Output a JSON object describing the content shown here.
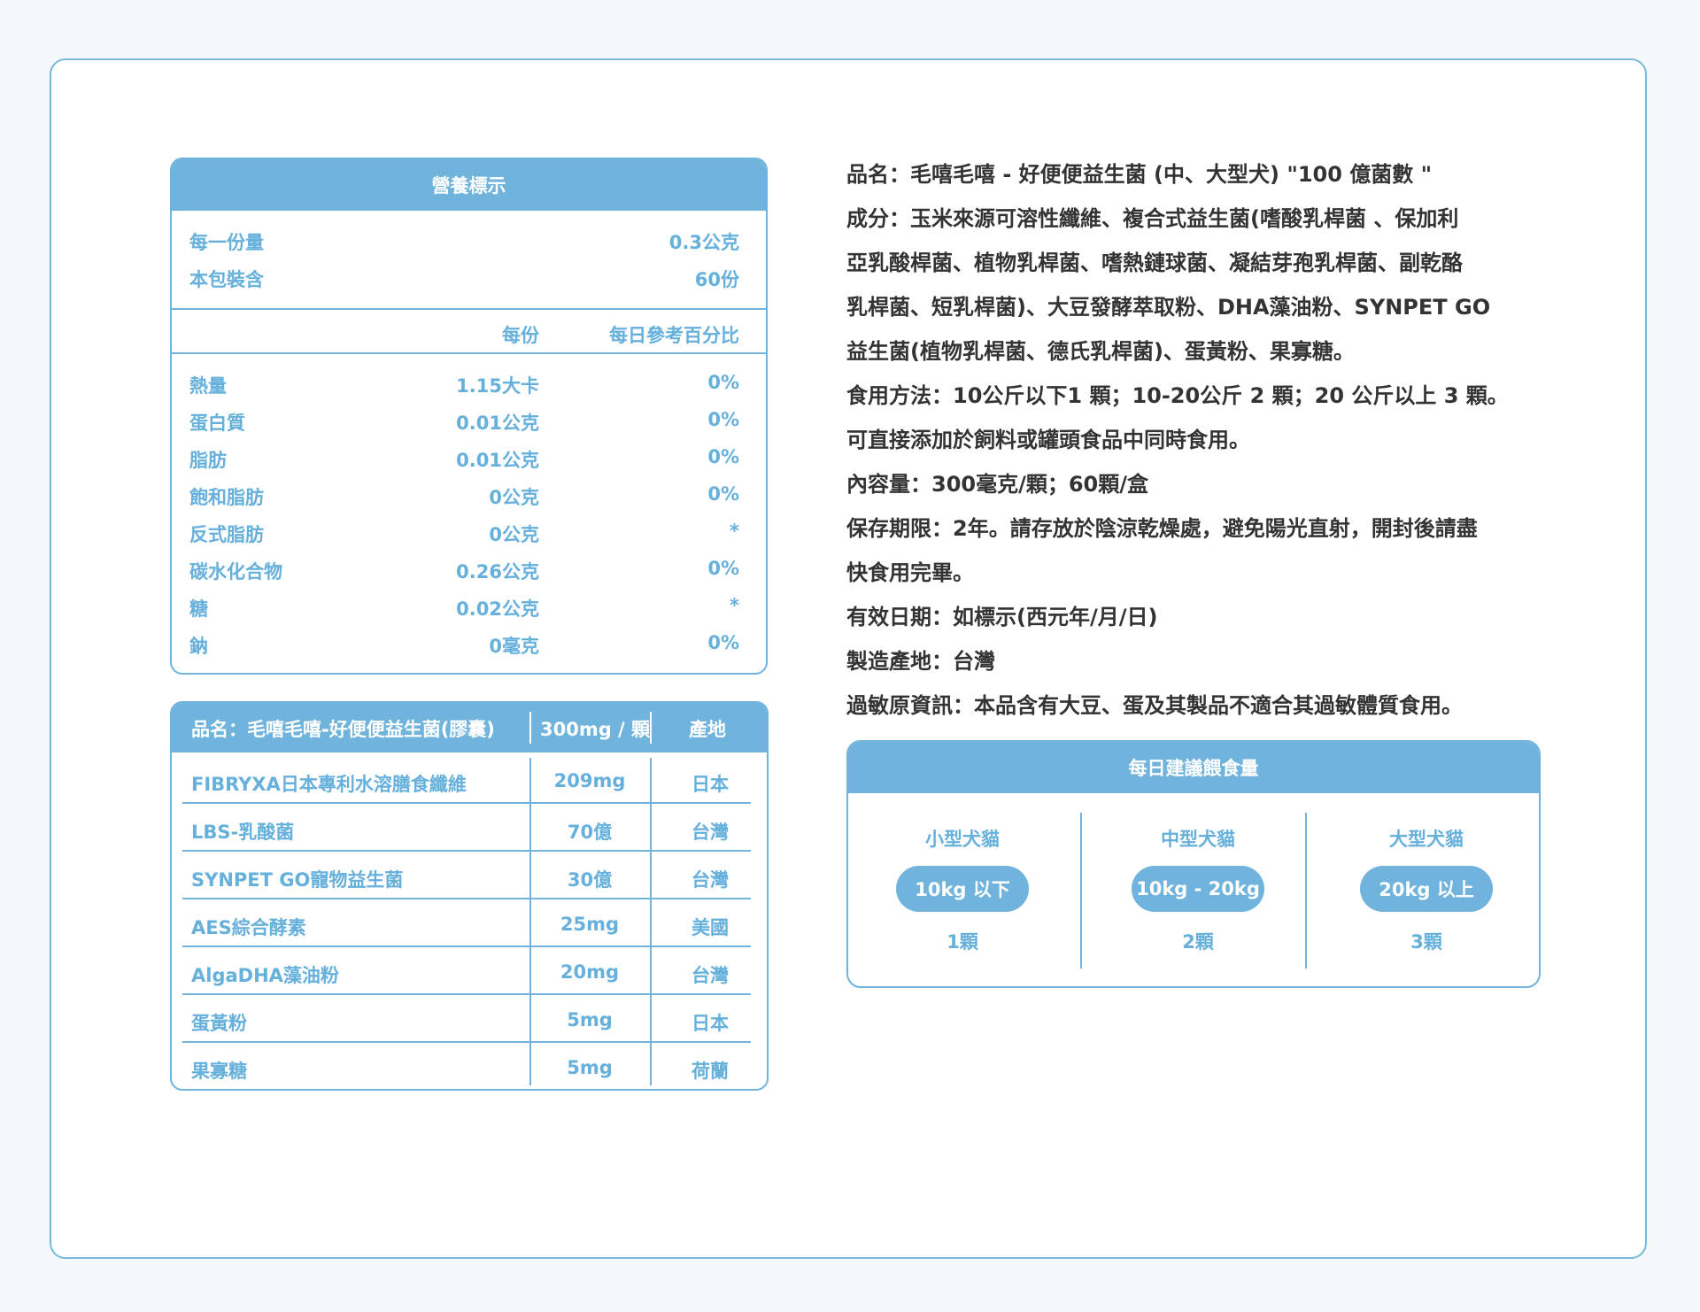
{
  "nutrition": {
    "title": "營養標示",
    "serving_label": "每一份量",
    "serving_value": "0.3公克",
    "package_label": "本包裝含",
    "package_value": "60份",
    "col_per": "每份",
    "col_daily": "每日參考百分比",
    "rows": [
      {
        "name": "熱量",
        "per": "1.15大卡",
        "daily": "0%"
      },
      {
        "name": "蛋白質",
        "per": "0.01公克",
        "daily": "0%"
      },
      {
        "name": "脂肪",
        "per": "0.01公克",
        "daily": "0%"
      },
      {
        "name": "飽和脂肪",
        "per": "0公克",
        "daily": "0%"
      },
      {
        "name": "反式脂肪",
        "per": "0公克",
        "daily": "*"
      },
      {
        "name": "碳水化合物",
        "per": "0.26公克",
        "daily": "0%"
      },
      {
        "name": "糖",
        "per": "0.02公克",
        "daily": "*"
      },
      {
        "name": "鈉",
        "per": "0毫克",
        "daily": "0%"
      }
    ]
  },
  "ingredients": {
    "header_name": "品名：毛嘻毛嘻-好便便益生菌(膠囊)",
    "header_amount": "300mg / 顆",
    "header_origin": "產地",
    "rows": [
      {
        "name": "FIBRYXA日本專利水溶膳食纖維",
        "amount": "209mg",
        "origin": "日本"
      },
      {
        "name": "LBS-乳酸菌",
        "amount": "70億",
        "origin": "台灣"
      },
      {
        "name": "SYNPET GO寵物益生菌",
        "amount": "30億",
        "origin": "台灣"
      },
      {
        "name": "AES綜合酵素",
        "amount": "25mg",
        "origin": "美國"
      },
      {
        "name": "AlgaDHA藻油粉",
        "amount": "20mg",
        "origin": "台灣"
      },
      {
        "name": "蛋黃粉",
        "amount": "5mg",
        "origin": "日本"
      },
      {
        "name": "果寡糖",
        "amount": "5mg",
        "origin": "荷蘭"
      }
    ]
  },
  "info": {
    "lines": [
      "品名：毛嘻毛嘻 - 好便便益生菌 (中、大型犬)  \"100 億菌數 \"",
      "成分：玉米來源可溶性纖維、複合式益生菌(嗜酸乳桿菌 、保加利",
      "亞乳酸桿菌、植物乳桿菌、嗜熱鏈球菌、凝結芽孢乳桿菌、副乾酪",
      "乳桿菌、短乳桿菌)、大豆發酵萃取粉、DHA藻油粉、SYNPET GO",
      "益生菌(植物乳桿菌、德氏乳桿菌)、蛋黃粉、果寡糖。",
      "食用方法：10公斤以下1 顆；10-20公斤 2 顆；20 公斤以上 3 顆。",
      "可直接添加於飼料或罐頭食品中同時食用。",
      "內容量：300毫克/顆；60顆/盒",
      "保存期限：2年。請存放於陰涼乾燥處，避免陽光直射，開封後請盡",
      "快食用完畢。",
      "有效日期：如標示(西元年/月/日)",
      "製造產地：台灣",
      "過敏原資訊：本品含有大豆、蛋及其製品不適合其過敏體質食用。"
    ]
  },
  "daily": {
    "title": "每日建議餵食量",
    "columns": [
      {
        "label": "小型犬貓",
        "range": "10kg 以下",
        "count": "1顆"
      },
      {
        "label": "中型犬貓",
        "range": "10kg - 20kg",
        "count": "2顆"
      },
      {
        "label": "大型犬貓",
        "range": "20kg 以上",
        "count": "3顆"
      }
    ]
  },
  "colors": {
    "accent": "#70b3dc",
    "text": "#333333",
    "background": "#f4f8fb"
  }
}
